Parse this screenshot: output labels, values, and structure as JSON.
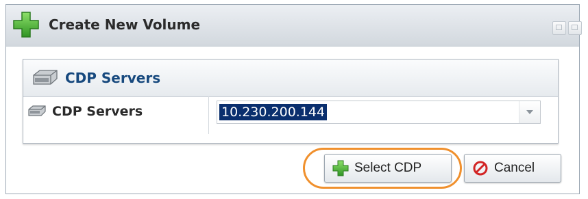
{
  "window": {
    "title": "Create New Volume"
  },
  "panel": {
    "header_title": "CDP Servers",
    "field_label": "CDP Servers",
    "selected_server": "10.230.200.144"
  },
  "buttons": {
    "select_label": "Select CDP",
    "cancel_label": "Cancel"
  },
  "colors": {
    "accent_title": "#17497e",
    "highlight": "#f0902d",
    "plus_green": "#3aa02f",
    "cancel_red": "#d22424"
  },
  "icons": [
    "add-icon",
    "server-icon",
    "restore-icon",
    "close-icon",
    "dropdown-arrow-icon",
    "cancel-icon"
  ]
}
